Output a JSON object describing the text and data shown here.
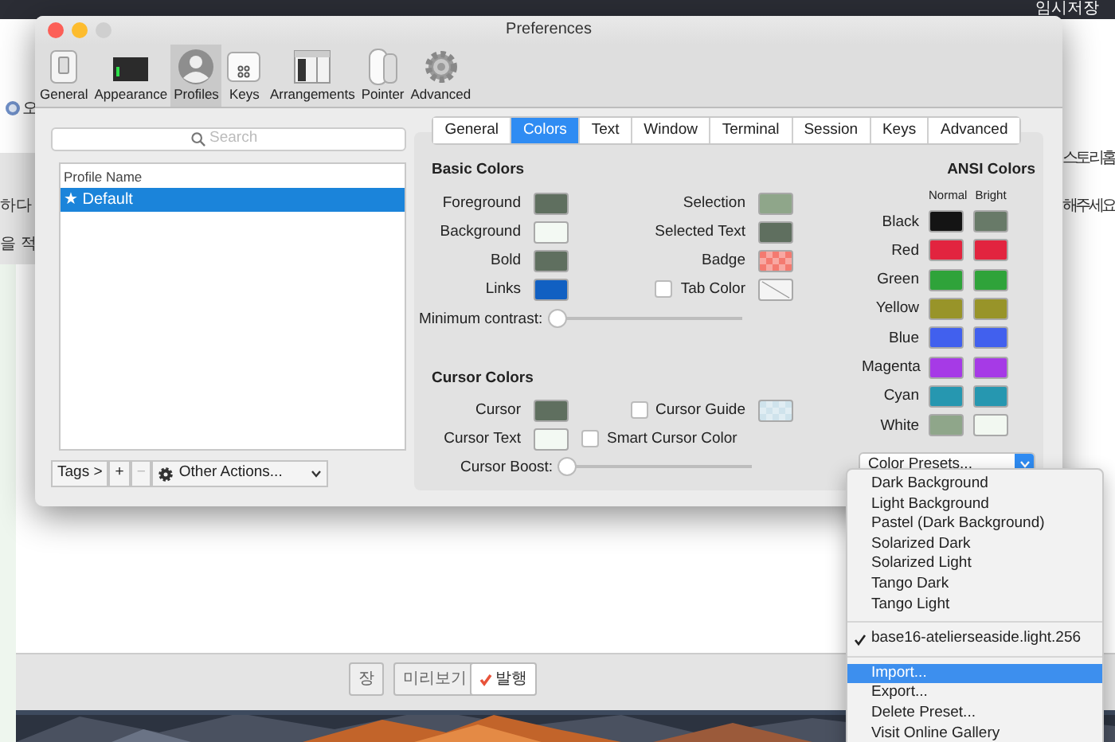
{
  "background_window": {
    "header_text": "임시저장",
    "texts": [
      "오",
      "하다",
      "을 적",
      "스토리홈",
      "해주세요"
    ],
    "buttons": [
      {
        "label": "장",
        "checked": false
      },
      {
        "label": "미리보기",
        "checked": false
      },
      {
        "label": "발행",
        "checked": true
      }
    ]
  },
  "window": {
    "title": "Preferences"
  },
  "toolbar": [
    {
      "label": "General",
      "kind": "general",
      "selected": false
    },
    {
      "label": "Appearance",
      "kind": "appearance",
      "selected": false
    },
    {
      "label": "Profiles",
      "kind": "profiles",
      "selected": true
    },
    {
      "label": "Keys",
      "kind": "keys",
      "selected": false
    },
    {
      "label": "Arrangements",
      "kind": "arrangements",
      "selected": false
    },
    {
      "label": "Pointer",
      "kind": "pointer",
      "selected": false
    },
    {
      "label": "Advanced",
      "kind": "advanced",
      "selected": false
    }
  ],
  "profiles": {
    "search_placeholder": "Search",
    "column": "Profile Name",
    "items": [
      {
        "label": "★ Default",
        "selected": true
      }
    ],
    "tags_button": "Tags >",
    "add_button": {
      "label": "+",
      "disabled": false
    },
    "remove_button": {
      "label": "−",
      "disabled": true
    },
    "other_actions": "Other Actions..."
  },
  "tabs": [
    {
      "label": "General",
      "selected": false
    },
    {
      "label": "Colors",
      "selected": true
    },
    {
      "label": "Text",
      "selected": false
    },
    {
      "label": "Window",
      "selected": false
    },
    {
      "label": "Terminal",
      "selected": false
    },
    {
      "label": "Session",
      "selected": false
    },
    {
      "label": "Keys",
      "selected": false
    },
    {
      "label": "Advanced",
      "selected": false
    }
  ],
  "basic_colors": {
    "title": "Basic Colors",
    "left": [
      {
        "label": "Foreground",
        "kind": "solid",
        "color": "#5f6f5f"
      },
      {
        "label": "Background",
        "kind": "solid",
        "color": "#f3f9f3"
      },
      {
        "label": "Bold",
        "kind": "solid",
        "color": "#5f6f5f"
      },
      {
        "label": "Links",
        "kind": "solid",
        "color": "#1160c2"
      }
    ],
    "right": [
      {
        "label": "Selection",
        "kind": "solid",
        "color": "#8fa68a"
      },
      {
        "label": "Selected Text",
        "kind": "solid",
        "color": "#5f6f5f"
      },
      {
        "label": "Badge",
        "kind": "checker",
        "color": "#f47a70"
      },
      {
        "label": "Tab Color",
        "kind": "none",
        "checked": false
      }
    ],
    "slider": {
      "label": "Minimum contrast:",
      "level": 0
    }
  },
  "cursor_colors": {
    "title": "Cursor Colors",
    "left": [
      {
        "label": "Cursor",
        "kind": "solid",
        "color": "#5f6f5f"
      },
      {
        "label": "Cursor Text",
        "kind": "solid",
        "color": "#f3f9f3"
      }
    ],
    "right": [
      {
        "label": "Cursor Guide",
        "kind": "checker",
        "color": "#cfe3ec",
        "checked": false
      },
      {
        "label": "Smart Cursor Color",
        "kind": "nothing",
        "checked": false
      }
    ],
    "slider": {
      "label": "Cursor Boost:",
      "level": 0
    }
  },
  "ansi_colors": {
    "title": "ANSI Colors",
    "normal_header": "Normal",
    "bright_header": "Bright",
    "rows": [
      {
        "name": "Black",
        "normal": {
          "color": "#141414"
        },
        "bright": {
          "color": "#687a68"
        }
      },
      {
        "name": "Red",
        "normal": {
          "color": "#e2243f"
        },
        "bright": {
          "color": "#e2243f"
        }
      },
      {
        "name": "Green",
        "normal": {
          "color": "#2fa33a"
        },
        "bright": {
          "color": "#2fa33a"
        }
      },
      {
        "name": "Yellow",
        "normal": {
          "color": "#989429"
        },
        "bright": {
          "color": "#989429"
        }
      },
      {
        "name": "Blue",
        "normal": {
          "color": "#4160ee"
        },
        "bright": {
          "color": "#4160ee"
        }
      },
      {
        "name": "Magenta",
        "normal": {
          "color": "#a63ae6"
        },
        "bright": {
          "color": "#a63ae6"
        }
      },
      {
        "name": "Cyan",
        "normal": {
          "color": "#2697b0"
        },
        "bright": {
          "color": "#2697b0"
        }
      },
      {
        "name": "White",
        "normal": {
          "color": "#8fa68a"
        },
        "bright": {
          "color": "#f2f8f1"
        }
      }
    ]
  },
  "color_presets": {
    "label": "Color Presets...",
    "menu": [
      [
        {
          "label": "Dark Background",
          "checked": false,
          "selected": false
        },
        {
          "label": "Light Background",
          "checked": false,
          "selected": false
        },
        {
          "label": "Pastel (Dark Background)",
          "checked": false,
          "selected": false
        },
        {
          "label": "Solarized Dark",
          "checked": false,
          "selected": false
        },
        {
          "label": "Solarized Light",
          "checked": false,
          "selected": false
        },
        {
          "label": "Tango Dark",
          "checked": false,
          "selected": false
        },
        {
          "label": "Tango Light",
          "checked": false,
          "selected": false
        }
      ],
      [
        {
          "label": "base16-atelierseaside.light.256",
          "checked": true,
          "selected": false
        }
      ],
      [
        {
          "label": "Import...",
          "checked": false,
          "selected": true
        },
        {
          "label": "Export...",
          "checked": false,
          "selected": false
        },
        {
          "label": "Delete Preset...",
          "checked": false,
          "selected": false
        },
        {
          "label": "Visit Online Gallery",
          "checked": false,
          "selected": false
        }
      ]
    ]
  }
}
